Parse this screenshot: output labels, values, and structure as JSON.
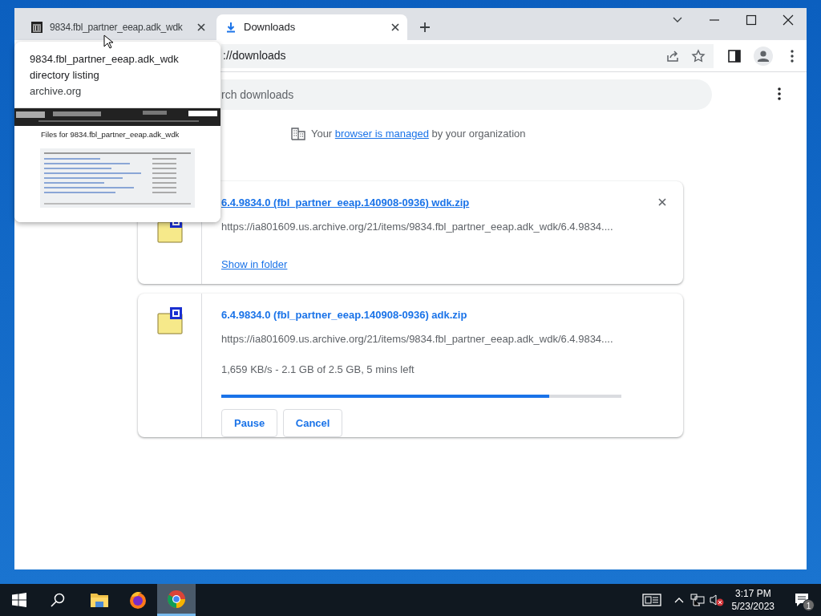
{
  "tabs": [
    {
      "title": "9834.fbl_partner_eeap.adk_wdk",
      "kind": "archive",
      "selected": false
    },
    {
      "title": "Downloads",
      "kind": "download",
      "selected": true
    }
  ],
  "hover_card": {
    "title": "9834.fbl_partner_eeap.adk_wdk directory listing",
    "domain": "archive.org",
    "preview_heading": "Files for 9834.fbl_partner_eeap.adk_wdk"
  },
  "address_bar": {
    "url": "://downloads"
  },
  "search": {
    "placeholder": "rch downloads"
  },
  "managed_notice": {
    "before": "Your",
    "link": "browser is managed",
    "after": "by your organization"
  },
  "downloads": [
    {
      "kind": "complete",
      "file_name": "6.4.9834.0 (fbl_partner_eeap.140908-0936) wdk.zip",
      "url": "https://ia801609.us.archive.org/21/items/9834.fbl_partner_eeap.adk_wdk/6.4.9834....",
      "link": "Show in folder"
    },
    {
      "kind": "in_progress",
      "file_name": "6.4.9834.0 (fbl_partner_eeap.140908-0936) adk.zip",
      "url": "https://ia801609.us.archive.org/21/items/9834.fbl_partner_eeap.adk_wdk/6.4.9834....",
      "status": "1,659 KB/s - 2.1 GB of 2.5 GB, 5 mins left",
      "level": 0.82,
      "buttons": [
        "Pause",
        "Cancel"
      ]
    }
  ],
  "taskbar": {
    "apps": [
      {
        "kind": "explorer",
        "selected": false
      },
      {
        "kind": "firefox",
        "selected": false
      },
      {
        "kind": "chrome",
        "selected": true
      }
    ],
    "time": "3:17 PM",
    "date": "5/23/2023",
    "notification_count": "1"
  }
}
